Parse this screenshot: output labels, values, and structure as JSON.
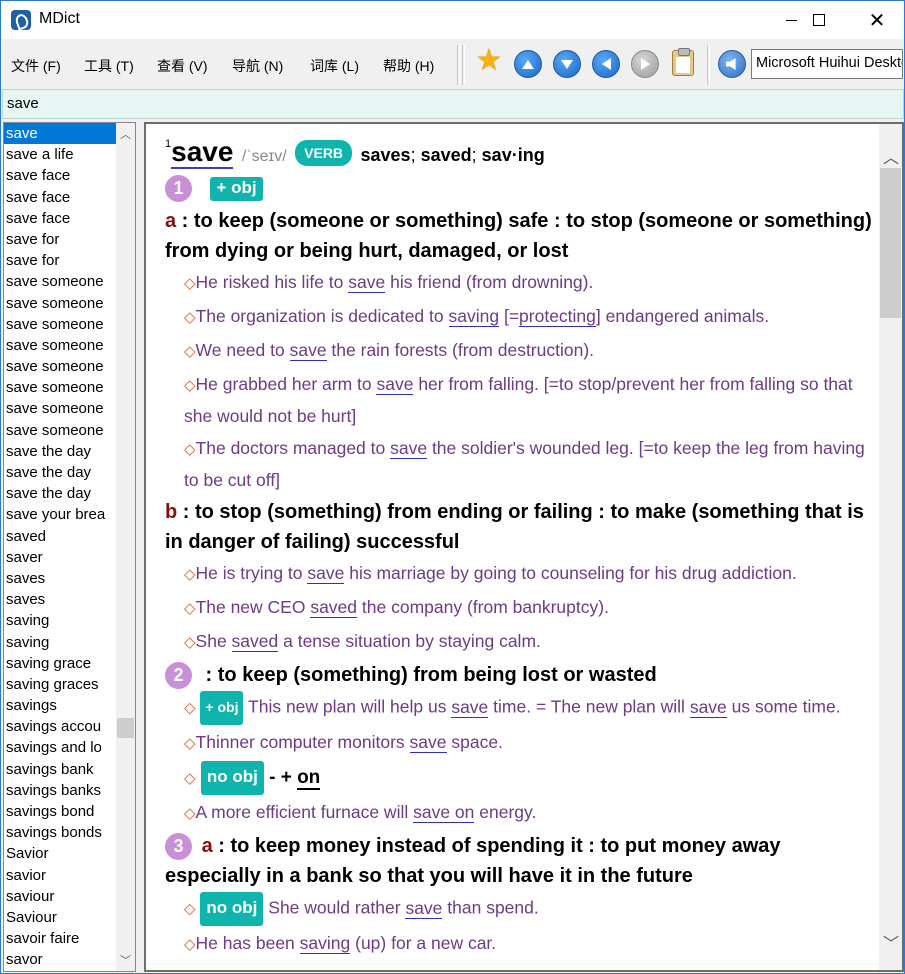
{
  "window": {
    "title": "MDict",
    "minimize": "–",
    "maximize": "□",
    "close": "✕"
  },
  "menu": [
    "文件 (F)",
    "工具 (T)",
    "查看 (V)",
    "导航 (N)",
    "词库 (L)",
    "帮助 (H)"
  ],
  "toolbar": {
    "icons": [
      "star-icon",
      "arrow-up-icon",
      "arrow-down-icon",
      "back-icon",
      "forward-icon",
      "clipboard-icon",
      "speaker-icon"
    ],
    "voice": "Microsoft Huihui Desktop"
  },
  "search": {
    "value": "save"
  },
  "wordlist": {
    "items": [
      "save",
      "save a life",
      "save face",
      "save face",
      "save face",
      "save for",
      "save for",
      "save someone",
      "save someone",
      "save someone",
      "save someone",
      "save someone",
      "save someone",
      "save someone",
      "save someone",
      "save the day",
      "save the day",
      "save the day",
      "save your brea",
      "saved",
      "saver",
      "saves",
      "saves",
      "saving",
      "saving",
      "saving grace",
      "saving graces",
      "savings",
      "savings accou",
      "savings and lo",
      "savings bank",
      "savings banks",
      "savings bond",
      "savings bonds",
      "Savior",
      "savior",
      "saviour",
      "Saviour",
      "savoir faire",
      "savor"
    ],
    "selected_index": 0
  },
  "entry": {
    "hom": "1",
    "headword": "save",
    "pron": "/ˈseɪv/",
    "pos": "VERB",
    "forms": {
      "f1": "saves",
      "f2": "saved",
      "f3": "sav·ing",
      "sep": ";"
    },
    "s1": {
      "num": "1",
      "gram": "+ obj",
      "a": {
        "letter": "a",
        "def": " : to keep (someone or something) safe : to stop (someone or something) from dying or being hurt, damaged, or lost",
        "ex1": {
          "pre": "He risked his life to ",
          "hl": "save",
          "post": " his friend (from drowning)."
        },
        "ex2": {
          "pre": "The organization is dedicated to ",
          "hl": "saving",
          "mid": " [=",
          "hl2": "protecting",
          "post": "] endangered animals."
        },
        "ex3": {
          "pre": "We need to ",
          "hl": "save",
          "post": " the rain forests (from destruction)."
        },
        "ex4": {
          "pre": "He grabbed her arm to ",
          "hl": "save",
          "post": " her from falling. [=to stop/prevent her from falling so that she would not be hurt]"
        },
        "ex5": {
          "pre": "The doctors managed to ",
          "hl": "save",
          "post": " the soldier's wounded leg. [=to keep the leg from having to be cut off]"
        }
      },
      "b": {
        "letter": "b",
        "def": " : to stop (something) from ending or failing : to make (something that is in danger of failing) successful",
        "ex1": {
          "pre": "He is trying to ",
          "hl": "save",
          "post": " his marriage by going to counseling for his drug addiction."
        },
        "ex2": {
          "pre": "The new CEO ",
          "hl": "saved",
          "post": " the company (from bankruptcy)."
        },
        "ex3": {
          "pre": "She ",
          "hl": "saved",
          "post": " a tense situation by staying calm."
        }
      }
    },
    "s2": {
      "num": "2",
      "def": " : to keep (something) from being lost or wasted",
      "ex1": {
        "gram": "+ obj",
        "pre": " This new plan will help us ",
        "hl": "save",
        "mid": " time. = The new plan will ",
        "hl2": "save",
        "post": " us some time."
      },
      "ex2": {
        "pre": "Thinner computer monitors ",
        "hl": "save",
        "post": " space."
      },
      "gram2": {
        "badge": "no obj",
        "pre": " - + ",
        "on": "on"
      },
      "ex3": {
        "pre": "A more efficient furnace will ",
        "hl": "save on",
        "post": " energy."
      }
    },
    "s3": {
      "num": "3",
      "letter": "a",
      "def": " : to keep money instead of spending it : to put money away especially in a bank so that you will have it in the future",
      "ex1": {
        "gram": "no obj",
        "pre": " She would rather ",
        "hl": "save",
        "post": " than spend."
      },
      "ex2": {
        "pre": "He has been ",
        "hl": "saving",
        "post": " (up) for a new car."
      }
    },
    "bullet": "◇"
  }
}
